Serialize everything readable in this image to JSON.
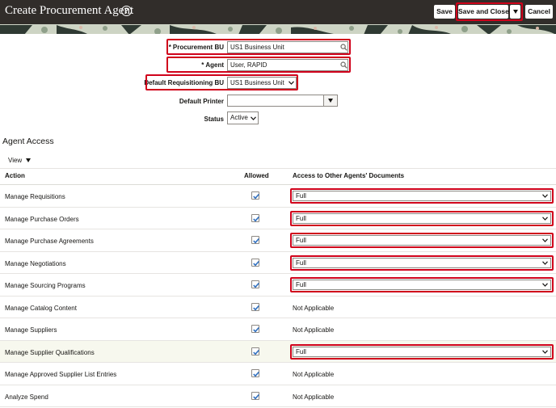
{
  "header": {
    "title": "Create Procurement Agent",
    "help_glyph": "?",
    "save_label": "Save",
    "save_close_label": "Save and Close",
    "cancel_label": "Cancel"
  },
  "form": {
    "procurement_bu": {
      "required_mark": "*",
      "label": "Procurement BU",
      "value": "US1 Business Unit"
    },
    "agent": {
      "required_mark": "*",
      "label": "Agent",
      "value": "User, RAPID"
    },
    "default_requisitioning_bu": {
      "label": "Default Requisitioning BU",
      "value": "US1 Business Unit"
    },
    "default_printer": {
      "label": "Default Printer",
      "value": ""
    },
    "status": {
      "label": "Status",
      "value": "Active"
    }
  },
  "agent_access": {
    "section_title": "Agent Access",
    "view_label": "View",
    "columns": {
      "action": "Action",
      "allowed": "Allowed",
      "access": "Access to Other Agents' Documents"
    },
    "rows": [
      {
        "action": "Manage Requisitions",
        "allowed": true,
        "access": "Full",
        "editable": true
      },
      {
        "action": "Manage Purchase Orders",
        "allowed": true,
        "access": "Full",
        "editable": true
      },
      {
        "action": "Manage Purchase Agreements",
        "allowed": true,
        "access": "Full",
        "editable": true
      },
      {
        "action": "Manage Negotiations",
        "allowed": true,
        "access": "Full",
        "editable": true
      },
      {
        "action": "Manage Sourcing Programs",
        "allowed": true,
        "access": "Full",
        "editable": true
      },
      {
        "action": "Manage Catalog Content",
        "allowed": true,
        "access": "Not Applicable",
        "editable": false
      },
      {
        "action": "Manage Suppliers",
        "allowed": true,
        "access": "Not Applicable",
        "editable": false
      },
      {
        "action": "Manage Supplier Qualifications",
        "allowed": true,
        "access": "Full",
        "editable": true
      },
      {
        "action": "Manage Approved Supplier List Entries",
        "allowed": true,
        "access": "Not Applicable",
        "editable": false
      },
      {
        "action": "Analyze Spend",
        "allowed": true,
        "access": "Not Applicable",
        "editable": false
      }
    ]
  },
  "colors": {
    "header_bg": "#312d2a",
    "highlight_red": "#d0021b",
    "checkbox_blue": "#2f6fbf"
  },
  "icons": {
    "help": "help-icon",
    "search": "search-icon",
    "dropdown": "chevron-down-icon",
    "check": "checkmark-icon"
  }
}
